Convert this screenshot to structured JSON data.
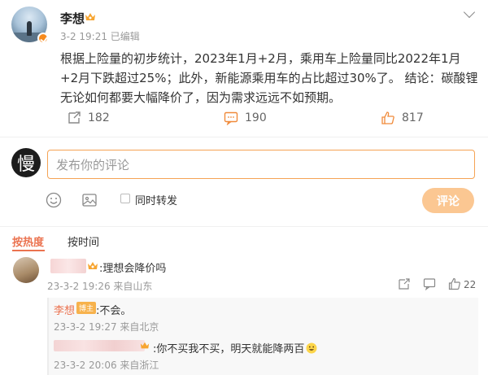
{
  "post": {
    "author": "李想",
    "meta": "3-2 19:21  已编辑",
    "content": "根据上险量的初步统计，2023年1月+2月，乘用车上险量同比2022年1月+2月下跌超过25%；此外，新能源乘用车的占比超过30%了。 结论：碳酸锂无论如何都要大幅降价了，因为需求远远不如预期。",
    "repost_count": "182",
    "comment_count": "190",
    "like_count": "817"
  },
  "composer": {
    "placeholder": "发布你的评论",
    "also_repost": "同时转发",
    "submit": "评论",
    "avatar_char": "慢"
  },
  "sort": {
    "hot": "按热度",
    "time": "按时间"
  },
  "comment": {
    "text": ":理想会降价吗",
    "meta": "23-3-2 19:26 来自山东",
    "like_count": "22"
  },
  "replies": [
    {
      "name": "李想",
      "tag": "博主",
      "text": ":不会。",
      "meta": "23-3-2 19:27 来自北京"
    },
    {
      "text": ":你不买我不买，明天就能降两百",
      "meta": "23-3-2 20:06 来自浙江"
    }
  ],
  "colors": {
    "accent": "#eb7350",
    "input_border": "#f5a354",
    "submit_bg": "#fbc792",
    "vip_badge": "#f78b1e"
  }
}
